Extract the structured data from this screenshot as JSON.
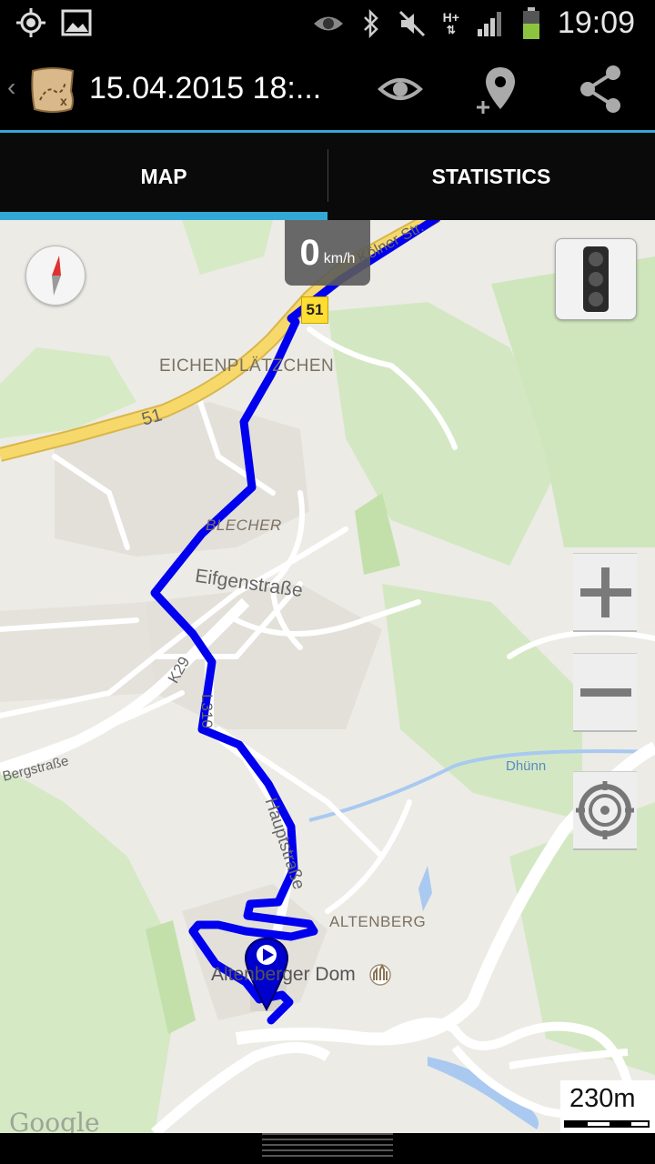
{
  "status_bar": {
    "time": "19:09",
    "network": "H+",
    "icons": [
      "gps-icon",
      "image-icon",
      "eye-icon",
      "bluetooth-icon",
      "mute-icon",
      "signal-icon",
      "battery-icon"
    ]
  },
  "action_bar": {
    "title": "15.04.2015 18:...",
    "actions": [
      "eye-icon",
      "add-location-icon",
      "share-icon"
    ]
  },
  "tabs": [
    {
      "label": "MAP",
      "active": true
    },
    {
      "label": "STATISTICS",
      "active": false
    }
  ],
  "map": {
    "speed": {
      "value": "0",
      "unit": "km/h"
    },
    "road_shield": "51",
    "labels": {
      "eichenplaetzchen": "EICHENPLÄTZCHEN",
      "road51": "51",
      "koelner": "Kölner Str.",
      "blecher": "BLECHER",
      "eifgen": "Eifgenstraße",
      "k29": "K29",
      "l310": "L310",
      "bergstrasse": "Bergstraße",
      "hauptstrasse": "Hauptstraße",
      "dhuenn": "Dhünn",
      "altenberg": "ALTENBERG",
      "dom": "Altenberger Dom"
    },
    "scale": "230m",
    "attribution": "Google",
    "colors": {
      "track": "#0000ee",
      "road_major": "#f7d96b",
      "water": "#a9c9f0",
      "park": "#c8e3b4"
    }
  }
}
